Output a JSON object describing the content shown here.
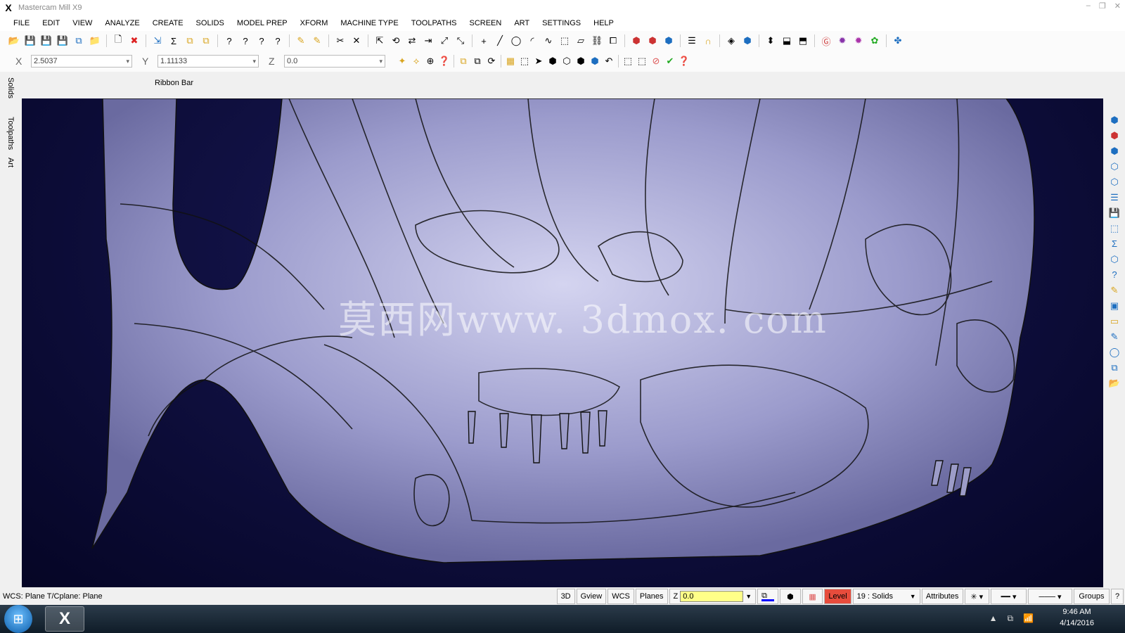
{
  "window": {
    "title": "Mastercam Mill X9",
    "app_icon": "X"
  },
  "menu": [
    "FILE",
    "EDIT",
    "VIEW",
    "ANALYZE",
    "CREATE",
    "SOLIDS",
    "MODEL PREP",
    "XFORM",
    "MACHINE TYPE",
    "TOOLPATHS",
    "SCREEN",
    "ART",
    "SETTINGS",
    "HELP"
  ],
  "coords": {
    "x_label": "X",
    "x_value": "2.5037",
    "y_label": "Y",
    "y_value": "1.11133",
    "z_label": "Z",
    "z_value": "0.0"
  },
  "ribbon_label": "Ribbon Bar",
  "left_tabs": [
    "Solids",
    "Toolpaths",
    "Art"
  ],
  "viewport": {
    "watermark": "莫西网www. 3dmox. com",
    "background": "#0a0a3a",
    "model_color": "#aaaadd"
  },
  "status": {
    "text": "WCS: Plane  T/Cplane: Plane",
    "buttons": [
      "3D",
      "Gview",
      "WCS",
      "Planes"
    ],
    "z_label": "Z",
    "z_value": "0.0",
    "level_label": "Level",
    "level_value": "19 : Solids",
    "attributes": "Attributes",
    "groups": "Groups",
    "help": "?"
  },
  "taskbar": {
    "time": "9:46 AM",
    "date": "4/14/2016"
  }
}
